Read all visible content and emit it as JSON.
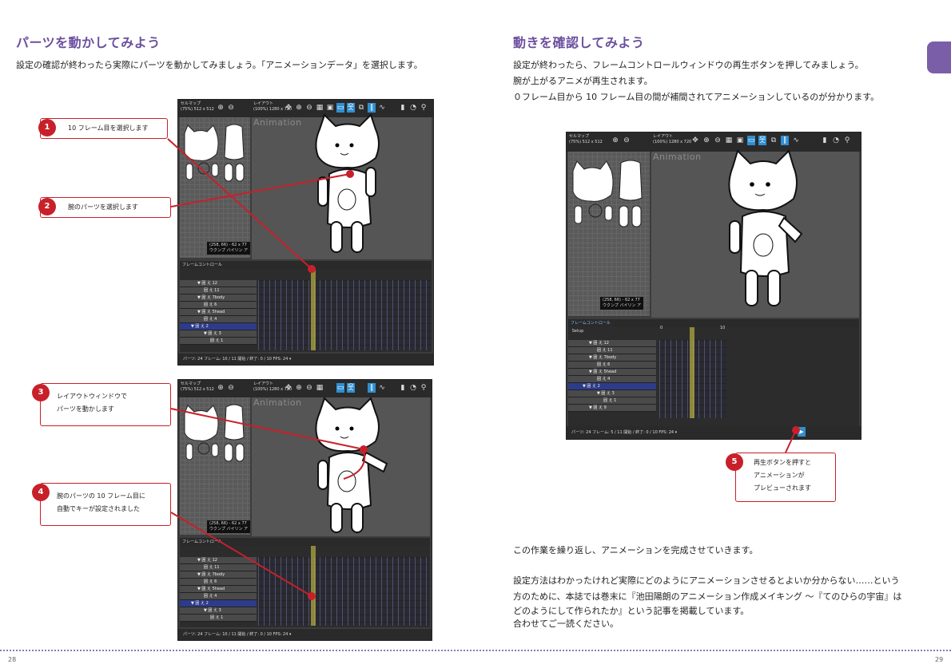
{
  "left": {
    "heading": "パーツを動かしてみよう",
    "para": "設定の確認が終わったら実際にパーツを動かしてみましょう。「アニメーションデータ」を選択します。",
    "page_number": "28"
  },
  "right": {
    "heading": "動きを確認してみよう",
    "para_lines": [
      "設定が終わったら、フレームコントロールウィンドウの再生ボタンを押してみましょう。",
      "腕が上がるアニメが再生されます。",
      "０フレーム目から 10 フレーム目の間が補間されてアニメーションしているのが分かります。"
    ],
    "para2": "この作業を繰り返し、アニメーションを完成させていきます。",
    "para3_lines": [
      "設定方法はわかったけれど実際にどのようにアニメーションさせるとよいか分からない……という",
      "方のために、本誌では巻末に『池田陽朗のアニメーション作成メイキング 〜『てのひらの宇宙』は",
      "どのようにして作られたか』という記事を掲載しています。",
      "合わせてご一読ください。"
    ],
    "page_number": "29"
  },
  "callouts": [
    {
      "num": "1",
      "text": "10 フレーム目を選択します"
    },
    {
      "num": "2",
      "text": "腕のパーツを選択します"
    },
    {
      "num": "3",
      "lines": [
        "レイアウトウィンドウで",
        "パーツを動かします"
      ]
    },
    {
      "num": "4",
      "lines": [
        "腕のパーツの 10 フレーム目に",
        "自動でキーが設定されました"
      ]
    },
    {
      "num": "5",
      "lines": [
        "再生ボタンを押すと",
        "アニメーションが",
        "プレビューされます"
      ]
    }
  ],
  "app": {
    "cellmap_title": "セルマップ",
    "cellmap_size": "(75%) 512 x 512",
    "layout_title": "レイアウト",
    "layout_size": "(100%) 1280 x 720",
    "watermark": "Animation",
    "frame_control": "フレームコントロール",
    "info_coords": "(258, 66) - 62 x 77",
    "info_label": "ウクンプ バイリン ア",
    "layers": [
      "▼ 囲 え 12",
      "囲 え 11",
      "▼ 囲 え 7body",
      "囲 え 6",
      "▼ 囲 え 5head",
      "囲 え 4",
      "▼ 囲 え 2",
      "▼ 囲 え 3",
      "囲 え 1",
      "▼ 囲 え 9"
    ],
    "status_shot1": "パーツ: 24    フレーム: 10   / 11    開始 / 終了: 0  / 10    FPS: 24 ▾",
    "status_shot2": "パーツ: 24    フレーム: 10   / 11    開始 / 終了: 0  / 10    FPS: 24 ▾",
    "status_shot3": "パーツ: 24     フレーム: 5    / 11    開始 / 終了: 0    / 10     FPS: 24 ▾",
    "tick0": "0",
    "tick10": "10",
    "setup_label": "Setup",
    "information_tab": "▾ information",
    "view_tab": "▾ view",
    "time_tab": "▾ time",
    "stats_tab": "▾ stats"
  },
  "colors": {
    "accent_purple": "#6b4f9e",
    "callout_red": "#c8202a",
    "tab_purple": "#7a5ea8"
  }
}
